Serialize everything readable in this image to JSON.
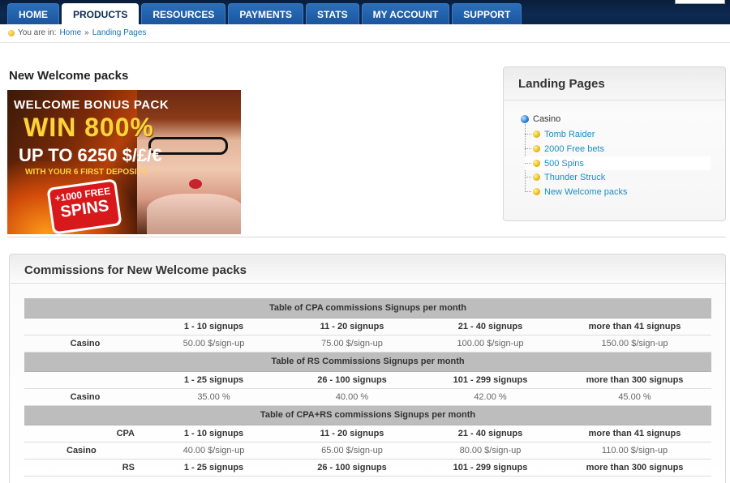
{
  "nav": {
    "items": [
      "HOME",
      "PRODUCTS",
      "RESOURCES",
      "PAYMENTS",
      "STATS",
      "MY ACCOUNT",
      "SUPPORT"
    ],
    "active": "PRODUCTS"
  },
  "breadcrumb": {
    "prefix": "You are in:",
    "home": "Home",
    "separator": "»",
    "current": "Landing Pages"
  },
  "page": {
    "title": "New Welcome packs"
  },
  "banner": {
    "line1": "WELCOME BONUS PACK",
    "line2": "WIN 800%",
    "line3": "UP TO 6250 $/£/€",
    "line4": "WITH YOUR 6 FIRST DEPOSITS",
    "badge_a": "+1000 FREE",
    "badge_b": "SPINS"
  },
  "landing_pages": {
    "title": "Landing Pages",
    "root": "Casino",
    "items": [
      "Tomb Raider",
      "2000 Free bets",
      "500 Spins",
      "Thunder Struck",
      "New Welcome packs"
    ],
    "selected": "500 Spins"
  },
  "commissions": {
    "title": "Commissions for New Welcome packs",
    "cpa": {
      "heading": "Table of CPA commissions Signups per month",
      "tiers": [
        "1 - 10 signups",
        "11 - 20 signups",
        "21 - 40 signups",
        "more than 41 signups"
      ],
      "row_label": "Casino",
      "values": [
        "50.00 $/sign-up",
        "75.00 $/sign-up",
        "100.00 $/sign-up",
        "150.00 $/sign-up"
      ]
    },
    "rs": {
      "heading": "Table of RS Commissions Signups per month",
      "tiers": [
        "1 - 25 signups",
        "26 - 100 signups",
        "101 - 299 signups",
        "more than 300 signups"
      ],
      "row_label": "Casino",
      "values": [
        "35.00 %",
        "40.00 %",
        "42.00 %",
        "45.00 %"
      ]
    },
    "hybrid": {
      "heading": "Table of CPA+RS commissions Signups per month",
      "cpa_label": "CPA",
      "cpa_tiers": [
        "1 - 10 signups",
        "11 - 20 signups",
        "21 - 40 signups",
        "more than 41 signups"
      ],
      "row_label": "Casino",
      "cpa_values": [
        "40.00 $/sign-up",
        "65.00 $/sign-up",
        "80.00 $/sign-up",
        "110.00 $/sign-up"
      ],
      "rs_label": "RS",
      "rs_tiers": [
        "1 - 25 signups",
        "26 - 100 signups",
        "101 - 299 signups",
        "more than 300 signups"
      ]
    }
  },
  "colors": {
    "nav_bg": "#0d2a52",
    "tab_blue": "#1b55a0",
    "link": "#1a8fc4",
    "table_group": "#bdbdbd"
  }
}
